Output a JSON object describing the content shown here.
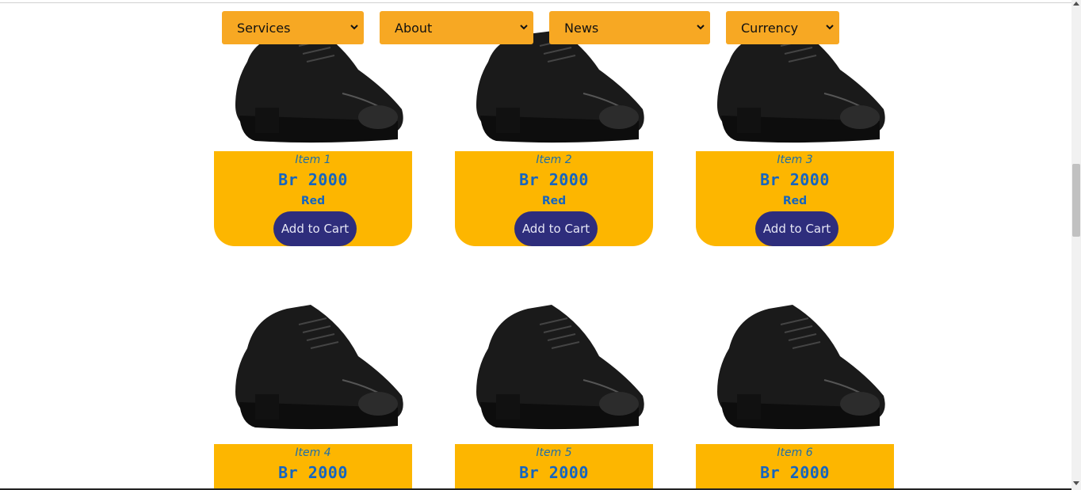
{
  "nav": {
    "services": "Services",
    "about": "About",
    "news": "News",
    "currency": "Currency"
  },
  "products": [
    {
      "name": "Item 1",
      "price": "Br 2000",
      "color": "Red",
      "button": "Add to Cart"
    },
    {
      "name": "Item 2",
      "price": "Br 2000",
      "color": "Red",
      "button": "Add to Cart"
    },
    {
      "name": "Item 3",
      "price": "Br 2000",
      "color": "Red",
      "button": "Add to Cart"
    },
    {
      "name": "Item 4",
      "price": "Br 2000"
    },
    {
      "name": "Item 5",
      "price": "Br 2000"
    },
    {
      "name": "Item 6",
      "price": "Br 2000"
    }
  ],
  "colors": {
    "nav_bg": "#f7a823",
    "card_bg": "#fdb600",
    "button_bg": "#2e2d7c",
    "price_text": "#1565c0"
  },
  "icons": [
    "chevron-down-icon",
    "shoe-image"
  ]
}
